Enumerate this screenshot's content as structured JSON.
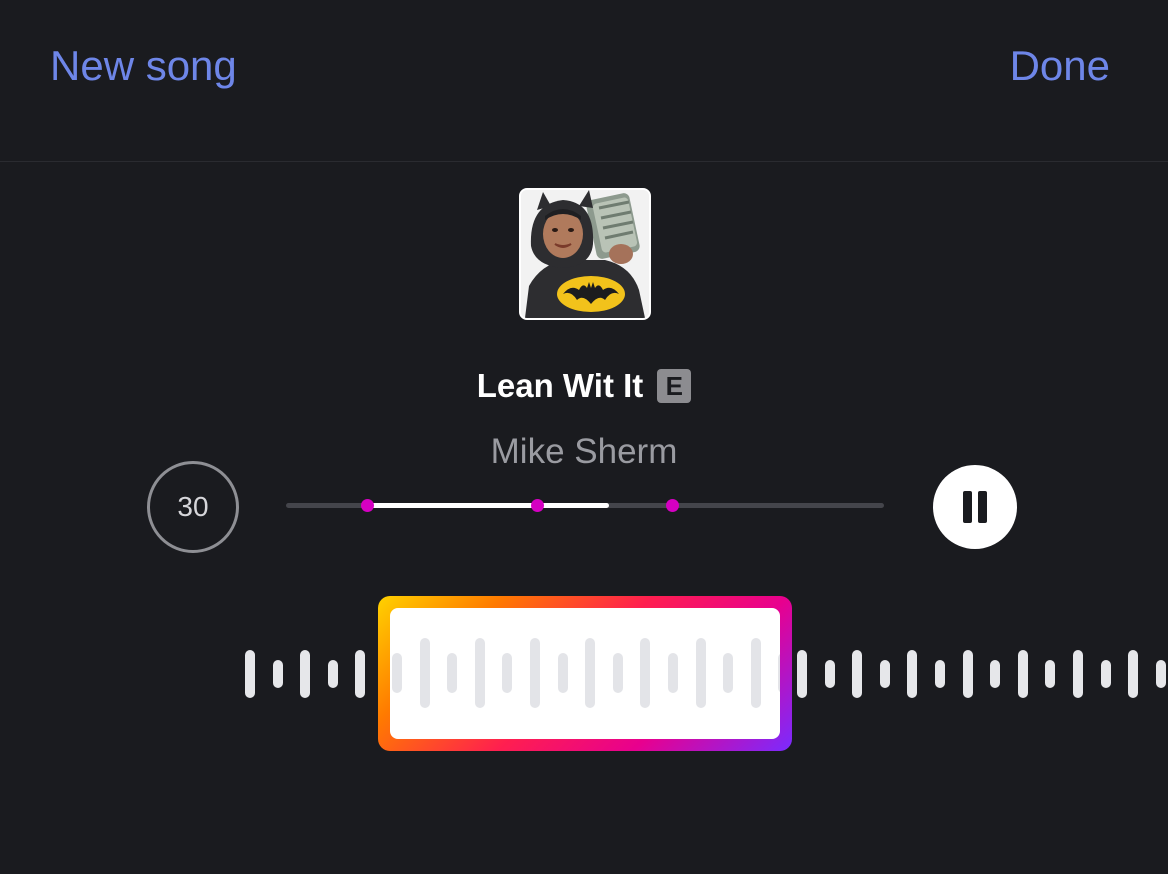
{
  "header": {
    "left_label": "New song",
    "right_label": "Done"
  },
  "song": {
    "title": "Lean Wit It",
    "explicit_badge": "E",
    "artist": "Mike Sherm",
    "artwork_icon": "album-art"
  },
  "player": {
    "clip_duration": "30",
    "pause_icon": "pause-icon",
    "progress": 0.54,
    "selection_start": 0.135,
    "selection_end": 0.54,
    "marker_positions": [
      0.135,
      0.42,
      0.645
    ]
  },
  "colors": {
    "background": "#1a1b1f",
    "accent": "#6e86e8",
    "marker": "#d500c2",
    "gradient": [
      "#ffd200",
      "#ff7a00",
      "#ff1f4f",
      "#e8008e",
      "#7a2bff"
    ]
  }
}
